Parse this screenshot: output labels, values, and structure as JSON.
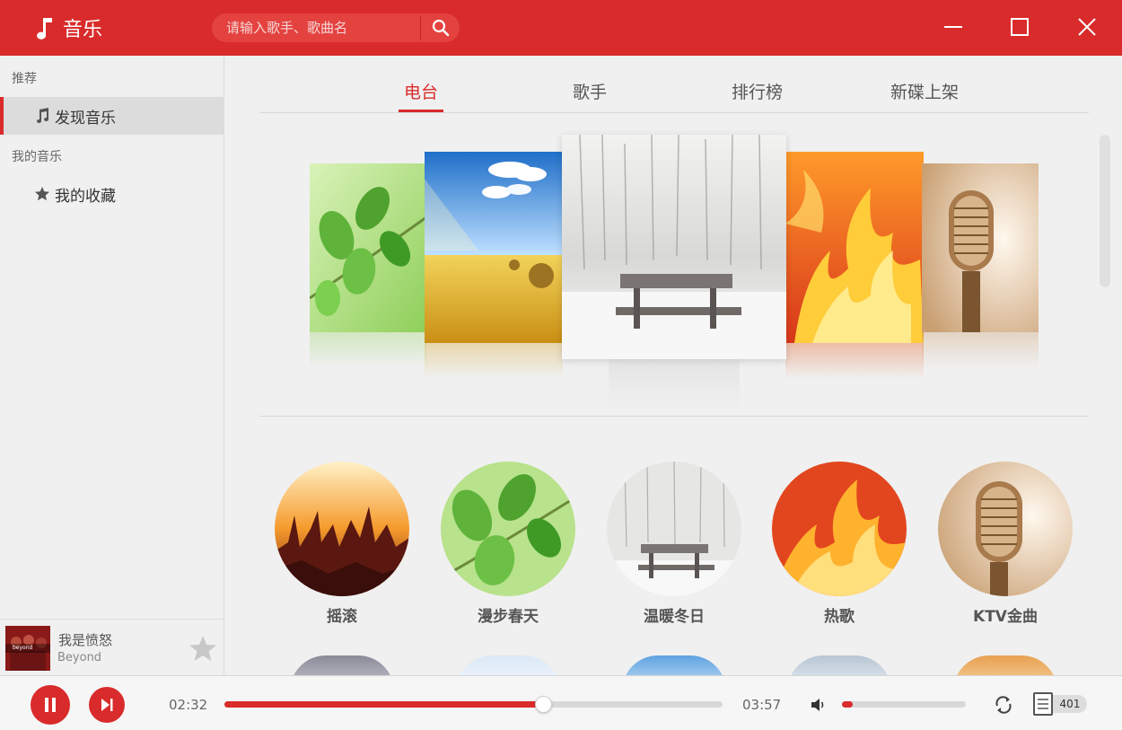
{
  "app": {
    "title": "音乐",
    "logo_icon": "music-note-icon"
  },
  "search": {
    "placeholder": "请输入歌手、歌曲名",
    "icon": "search-icon"
  },
  "window_controls": [
    "minimize-icon",
    "maximize-icon",
    "close-icon"
  ],
  "sidebar": {
    "sections": [
      {
        "title": "推荐",
        "items": [
          {
            "label": "发现音乐",
            "icon": "music-note-icon",
            "active": true
          }
        ]
      },
      {
        "title": "我的音乐",
        "items": [
          {
            "label": "我的收藏",
            "icon": "star-icon",
            "active": false
          }
        ]
      }
    ]
  },
  "now_playing": {
    "title": "我是愤怒",
    "artist": "Beyond",
    "cover_text": "beyond"
  },
  "tabs": [
    {
      "label": "电台",
      "active": true
    },
    {
      "label": "歌手",
      "active": false
    },
    {
      "label": "排行榜",
      "active": false
    },
    {
      "label": "新碟上架",
      "active": false
    }
  ],
  "carousel": [
    "spring-leaves",
    "wheat-field",
    "winter-bench",
    "fire",
    "microphone"
  ],
  "stations": [
    {
      "label": "摇滚",
      "image": "concert-crowd"
    },
    {
      "label": "漫步春天",
      "image": "spring-leaves"
    },
    {
      "label": "温暖冬日",
      "image": "winter-bench"
    },
    {
      "label": "热歌",
      "image": "fire"
    },
    {
      "label": "KTV金曲",
      "image": "microphone"
    }
  ],
  "player": {
    "current_time": "02:32",
    "total_time": "03:57",
    "progress": 0.64,
    "volume": 0.09,
    "playlist_count": "401",
    "accent": "#d92b2b"
  }
}
